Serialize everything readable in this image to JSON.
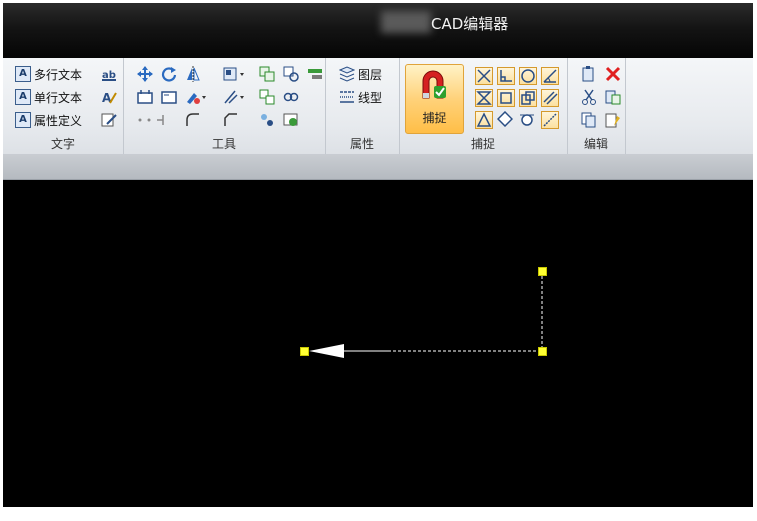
{
  "window": {
    "title_suffix": "CAD编辑器"
  },
  "ribbon": {
    "groups": {
      "text": {
        "label": "文字",
        "items": [
          {
            "label": "多行文本",
            "icon": "multiline-text-icon"
          },
          {
            "label": "单行文本",
            "icon": "singleline-text-icon"
          },
          {
            "label": "属性定义",
            "icon": "attribute-define-icon"
          }
        ]
      },
      "tools": {
        "label": "工具"
      },
      "properties": {
        "label": "属性",
        "items": [
          {
            "label": "图层",
            "icon": "layer-icon"
          },
          {
            "label": "线型",
            "icon": "linetype-icon"
          }
        ]
      },
      "snap": {
        "label": "捕捉",
        "big_button_label": "捕捉"
      },
      "edit": {
        "label": "编辑"
      }
    }
  },
  "colors": {
    "grip": "#ffff33",
    "canvas": "#000000",
    "snap_active": "#ffd27a",
    "delete": "#e02020"
  }
}
